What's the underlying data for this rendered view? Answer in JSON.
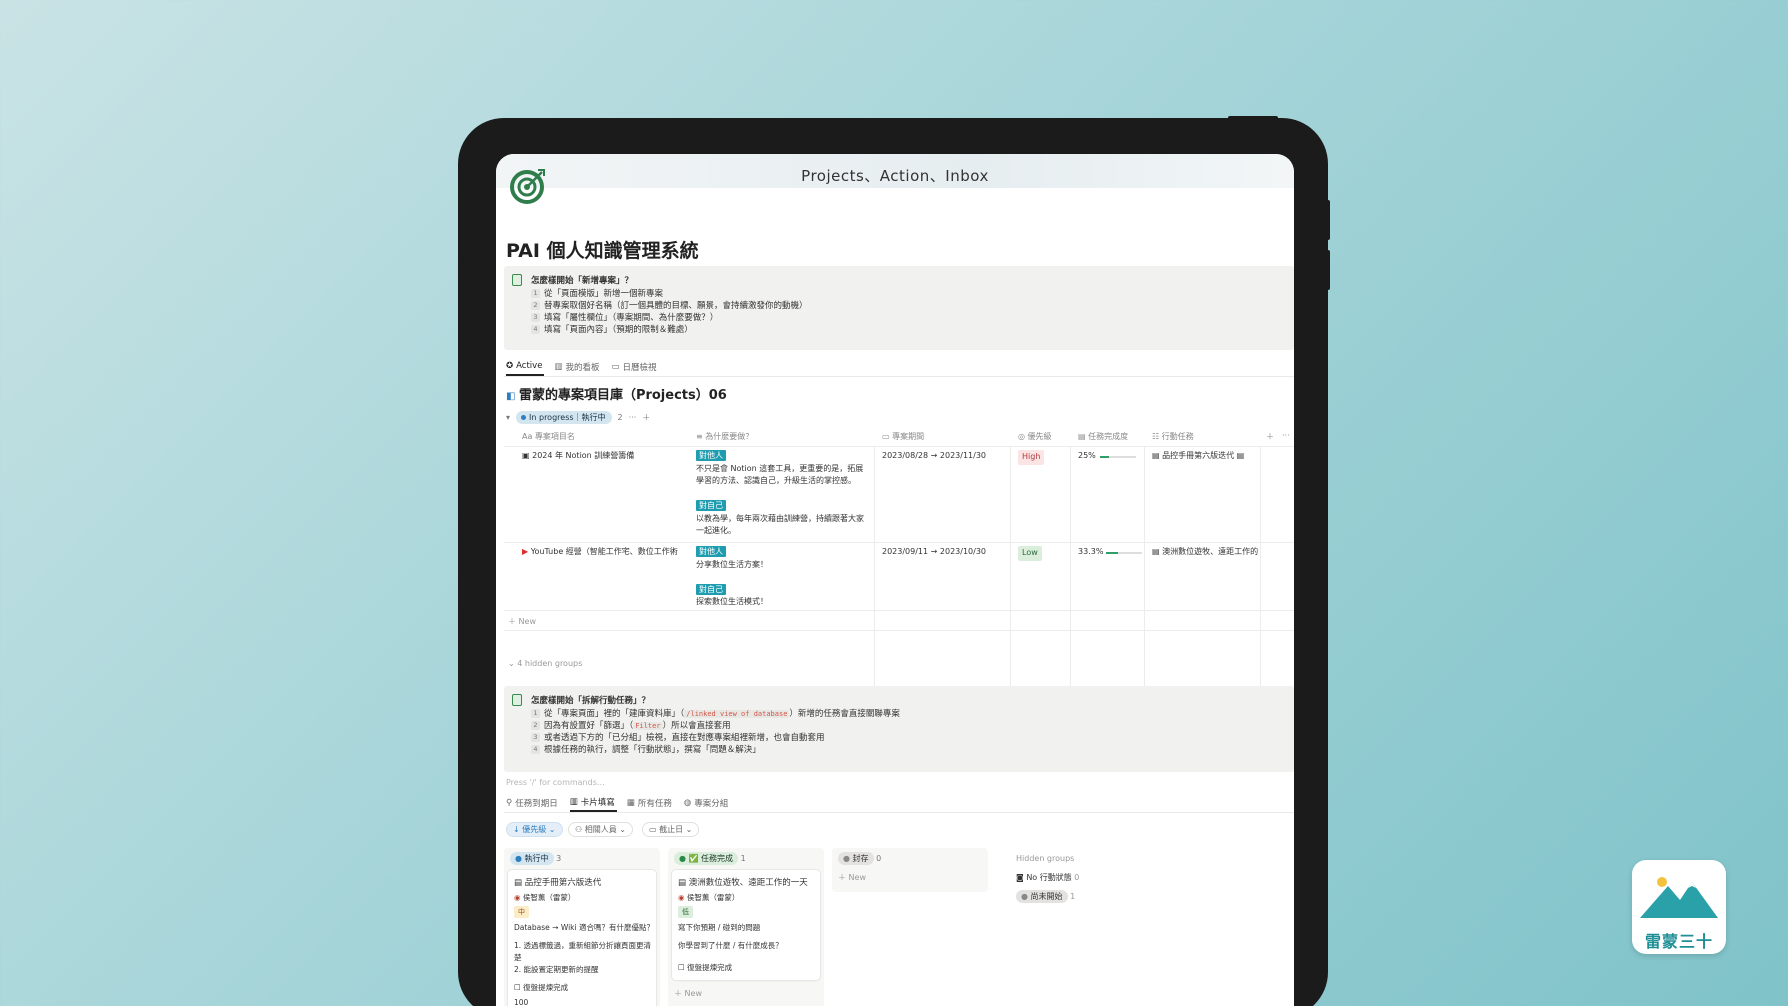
{
  "header": {
    "cover_title": "Projects、Action、Inbox",
    "page_title": "PAI 個人知識管理系統"
  },
  "callout1": {
    "title": "怎麼樣開始「新增專案」？",
    "items": [
      {
        "n": "1",
        "text": "從「頁面模版」新增一個新專案"
      },
      {
        "n": "2",
        "text": "替專案取個好名稱（訂一個具體的目標、願景，會持續激發你的動機）"
      },
      {
        "n": "3",
        "text": "填寫「屬性欄位」（專案期間、為什麼要做？）"
      },
      {
        "n": "4",
        "text": "填寫「頁面內容」（預期的限制＆難處）"
      }
    ]
  },
  "views": {
    "active": "Active",
    "board": "我的看板",
    "calendar": "日曆檢視"
  },
  "database": {
    "title": "雷蒙的專案項目庫（Projects）06",
    "group": {
      "label": "In progress｜執行中",
      "count": "2"
    },
    "columns": {
      "name": "專案項目名",
      "why": "為什麼要做？",
      "period": "專案期間",
      "priority": "優先級",
      "progress": "任務完成度",
      "actions": "行動任務"
    },
    "rows": [
      {
        "name": "2024 年 Notion 訓練營籌備",
        "tag_others": "對他人",
        "why_others": [
          "不只是會 Notion 這套工具，更重要的是，拓展",
          "學習的方法、認識自己，升級生活的掌控感。"
        ],
        "tag_self": "對自己",
        "why_self": [
          "以教為學，每年兩次藉由訓練營，持續跟著大家",
          "一起進化。"
        ],
        "period": "2023/08/28 → 2023/11/30",
        "priority": "High",
        "progress": "25%",
        "progress_value": 0.25,
        "action": "品控手冊第六版迭代"
      },
      {
        "name": "YouTube 經營（智能工作宅、數位工作術",
        "tag_others": "對他人",
        "why_others": [
          "分享數位生活方案！"
        ],
        "tag_self": "對自己",
        "why_self": [
          "探索數位生活模式！"
        ],
        "period": "2023/09/11 → 2023/10/30",
        "priority": "Low",
        "progress": "33.3%",
        "progress_value": 0.333,
        "action": "澳洲數位遊牧、遠距工作的"
      }
    ],
    "new_label": "New",
    "hidden_groups": "4 hidden groups"
  },
  "callout2": {
    "title": "怎麼樣開始「拆解行動任務」？",
    "items": [
      {
        "n": "1",
        "pre": "從「專案頁面」裡的「建庫資料庫」（",
        "code": "/linked view of database",
        "post": "）新增的任務會直接關聯專案"
      },
      {
        "n": "2",
        "pre": "因為有設置好「篩選」（",
        "code": "Filter",
        "post": "）所以會直接套用"
      },
      {
        "n": "3",
        "pre": "或者透過下方的「已分組」檢視，直接在對應專案組裡新增，也會自動套用",
        "code": "",
        "post": ""
      },
      {
        "n": "4",
        "pre": "根據任務的執行，調整「行動狀態」，撰寫「問題＆解決」",
        "code": "",
        "post": ""
      }
    ]
  },
  "press_hint": "Press '/' for commands…",
  "views2": {
    "due": "任務到期日",
    "card": "卡片填寫",
    "all": "所有任務",
    "group": "專案分組"
  },
  "filters": {
    "priority": "優先級",
    "people": "相關人員",
    "deadline": "截止日"
  },
  "board": {
    "columns": [
      {
        "label": "執行中",
        "count": "3"
      },
      {
        "label": "✅ 任務完成",
        "count": "1"
      },
      {
        "label": "封存",
        "count": "0"
      }
    ],
    "card1": {
      "title": "品控手冊第六版迭代",
      "person": "侯智薰（雷蒙）",
      "level": "中",
      "lines": [
        "Database → Wiki 適合嗎？有什麼優點？",
        "",
        "1. 透過標籤過，重新組節分折讓頁面更清楚",
        "2. 能設置定期更新的提醒"
      ],
      "check": "復盤提煉完成",
      "foot": "100"
    },
    "card2": {
      "title": "澳洲數位遊牧、遠距工作的一天",
      "person": "侯智薰（雷蒙）",
      "level": "低",
      "lines": [
        "寫下你預期 / 碰到的問題",
        "",
        "你學習到了什麼 / 有什麼成長？"
      ],
      "check": "復盤提煉完成"
    },
    "new_label": "New",
    "hidden_title": "Hidden groups",
    "hidden": [
      {
        "label": "No 行動狀態",
        "count": "0"
      },
      {
        "label": "尚未開始",
        "count": "1"
      }
    ]
  },
  "brand": {
    "name": "雷蒙三十"
  },
  "colors": {
    "accent": "#1f9db0",
    "high_bg": "#fbe4e4",
    "high_fg": "#b23b3b",
    "low_bg": "#dbeddb",
    "low_fg": "#2b6a3a"
  }
}
